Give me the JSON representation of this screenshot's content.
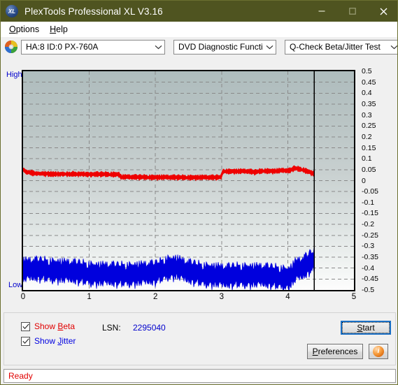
{
  "window": {
    "title": "PlexTools Professional XL V3.16",
    "app_icon": "plextools-xl-icon",
    "minimize_label": "–",
    "maximize_label": "□",
    "close_label": "✕"
  },
  "menubar": {
    "items": [
      {
        "label": "Options",
        "accel": "O"
      },
      {
        "label": "Help",
        "accel": "H"
      }
    ]
  },
  "toolbar": {
    "drive_icon": "optical-disc-icon",
    "drive": "HA:8 ID:0  PX-760A",
    "function": "DVD Diagnostic Functions",
    "test": "Q-Check Beta/Jitter Test"
  },
  "chart_panel": {
    "left_top_label": "High",
    "left_bottom_label": "Low"
  },
  "controls": {
    "show_beta_label": "Show Beta",
    "show_beta_accel": "B",
    "show_beta_checked": true,
    "show_jitter_label": "Show Jitter",
    "show_jitter_accel": "J",
    "show_jitter_checked": true,
    "lsn_label": "LSN:",
    "lsn_value": "2295040",
    "start_label": "Start",
    "start_accel": "S",
    "preferences_label": "Preferences",
    "preferences_accel": "P",
    "info_icon": "info-icon",
    "info_label": "i"
  },
  "statusbar": {
    "text": "Ready"
  },
  "colors": {
    "titlebar": "#4f5420",
    "beta_trace": "#ee0000",
    "jitter_trace": "#0000dd",
    "axis_label": "#0000cc",
    "status_text": "#e00000",
    "focus_outline": "#1a6fc4"
  },
  "chart_data": {
    "type": "line",
    "title": "",
    "xlabel": "",
    "ylabel": "",
    "xlim": [
      0,
      5
    ],
    "ylim": [
      -0.5,
      0.5
    ],
    "grid": true,
    "legend": "none",
    "y_ticks": [
      0.5,
      0.45,
      0.4,
      0.35,
      0.3,
      0.25,
      0.2,
      0.15,
      0.1,
      0.05,
      0,
      -0.05,
      -0.1,
      -0.15,
      -0.2,
      -0.25,
      -0.3,
      -0.35,
      -0.4,
      -0.45,
      -0.5
    ],
    "x_ticks": [
      0,
      1,
      2,
      3,
      4,
      5
    ],
    "y_left_labels": {
      "top": "High",
      "bottom": "Low"
    },
    "data_end_marker_x": 4.4,
    "series": [
      {
        "name": "Beta",
        "color": "#ee0000",
        "x_start": 0,
        "x_end": 4.4,
        "noise": 0.009,
        "segments": [
          {
            "x": 0.0,
            "y": 0.05
          },
          {
            "x": 0.06,
            "y": 0.04
          },
          {
            "x": 0.2,
            "y": 0.032
          },
          {
            "x": 0.6,
            "y": 0.03
          },
          {
            "x": 1.0,
            "y": 0.029
          },
          {
            "x": 1.45,
            "y": 0.028
          },
          {
            "x": 1.48,
            "y": 0.016
          },
          {
            "x": 1.9,
            "y": 0.015
          },
          {
            "x": 2.4,
            "y": 0.014
          },
          {
            "x": 2.9,
            "y": 0.014
          },
          {
            "x": 2.99,
            "y": 0.015
          },
          {
            "x": 3.02,
            "y": 0.042
          },
          {
            "x": 3.4,
            "y": 0.042
          },
          {
            "x": 3.5,
            "y": 0.038
          },
          {
            "x": 3.62,
            "y": 0.044
          },
          {
            "x": 3.8,
            "y": 0.043
          },
          {
            "x": 3.95,
            "y": 0.046
          },
          {
            "x": 4.02,
            "y": 0.044
          },
          {
            "x": 4.1,
            "y": 0.056
          },
          {
            "x": 4.22,
            "y": 0.05
          },
          {
            "x": 4.32,
            "y": 0.04
          },
          {
            "x": 4.4,
            "y": 0.03
          }
        ]
      },
      {
        "name": "Jitter",
        "color": "#0000dd",
        "x_start": 0,
        "x_end": 4.4,
        "noise": 0.042,
        "segments": [
          {
            "x": 0.0,
            "y": -0.41
          },
          {
            "x": 0.25,
            "y": -0.408
          },
          {
            "x": 0.6,
            "y": -0.415
          },
          {
            "x": 0.95,
            "y": -0.424
          },
          {
            "x": 1.05,
            "y": -0.428
          },
          {
            "x": 1.45,
            "y": -0.432
          },
          {
            "x": 1.75,
            "y": -0.428
          },
          {
            "x": 2.0,
            "y": -0.424
          },
          {
            "x": 2.18,
            "y": -0.4
          },
          {
            "x": 2.32,
            "y": -0.398
          },
          {
            "x": 2.48,
            "y": -0.418
          },
          {
            "x": 2.7,
            "y": -0.43
          },
          {
            "x": 2.95,
            "y": -0.436
          },
          {
            "x": 3.05,
            "y": -0.44
          },
          {
            "x": 3.3,
            "y": -0.434
          },
          {
            "x": 3.6,
            "y": -0.436
          },
          {
            "x": 3.9,
            "y": -0.444
          },
          {
            "x": 4.02,
            "y": -0.448
          },
          {
            "x": 4.12,
            "y": -0.412
          },
          {
            "x": 4.24,
            "y": -0.4
          },
          {
            "x": 4.33,
            "y": -0.378
          },
          {
            "x": 4.4,
            "y": -0.368
          }
        ]
      }
    ]
  }
}
